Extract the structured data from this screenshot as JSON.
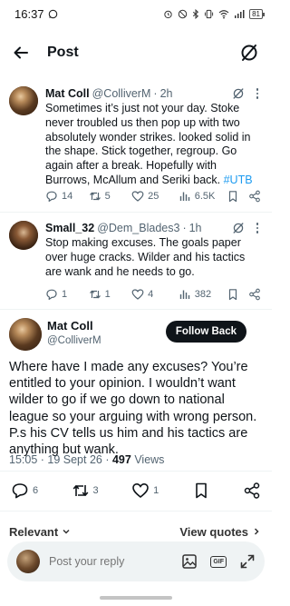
{
  "status_bar": {
    "time": "16:37",
    "battery": "81"
  },
  "header": {
    "title": "Post"
  },
  "tweets": [
    {
      "name": "Mat Coll",
      "handle": "@ColliverM",
      "sep": "·",
      "time": "2h",
      "text": "Sometimes it’s just not your day. Stoke never troubled us then pop up with two absolutely wonder strikes. looked solid in the shape. Stick together, regroup. Go again after a break. Hopefully with Burrows, McAllum and Seriki back.",
      "hashtag": "#UTB",
      "replies": "14",
      "reposts": "5",
      "likes": "25",
      "views": "6.5K"
    },
    {
      "name": "Small_32",
      "handle": "@Dem_Blades3",
      "sep": "·",
      "time": "1h",
      "text": "Stop making excuses. The goals paper over huge cracks. Wilder and his tactics are wank and he needs to go.",
      "replies": "1",
      "reposts": "1",
      "likes": "4",
      "views": "382"
    }
  ],
  "main_tweet": {
    "name": "Mat Coll",
    "handle": "@ColliverM",
    "follow_label": "Follow Back",
    "text": "Where have I made any excuses? You’re entitled to your opinion. I wouldn’t want wilder to go if we go down to national league so your arguing with wrong person. P.s his CV tells us him and his tactics are anything but wank.",
    "time": "15:05",
    "date": "19 Sept 26",
    "views_count": "497",
    "views_label": "Views",
    "replies": "6",
    "reposts": "3",
    "likes": "1"
  },
  "sort": {
    "relevant_label": "Relevant",
    "view_quotes_label": "View quotes"
  },
  "reply_bar": {
    "placeholder": "Post your reply",
    "gif_label": "GIF"
  },
  "colors": {
    "accent": "#1d9bf0",
    "text": "#0f1419",
    "muted": "#536471"
  }
}
